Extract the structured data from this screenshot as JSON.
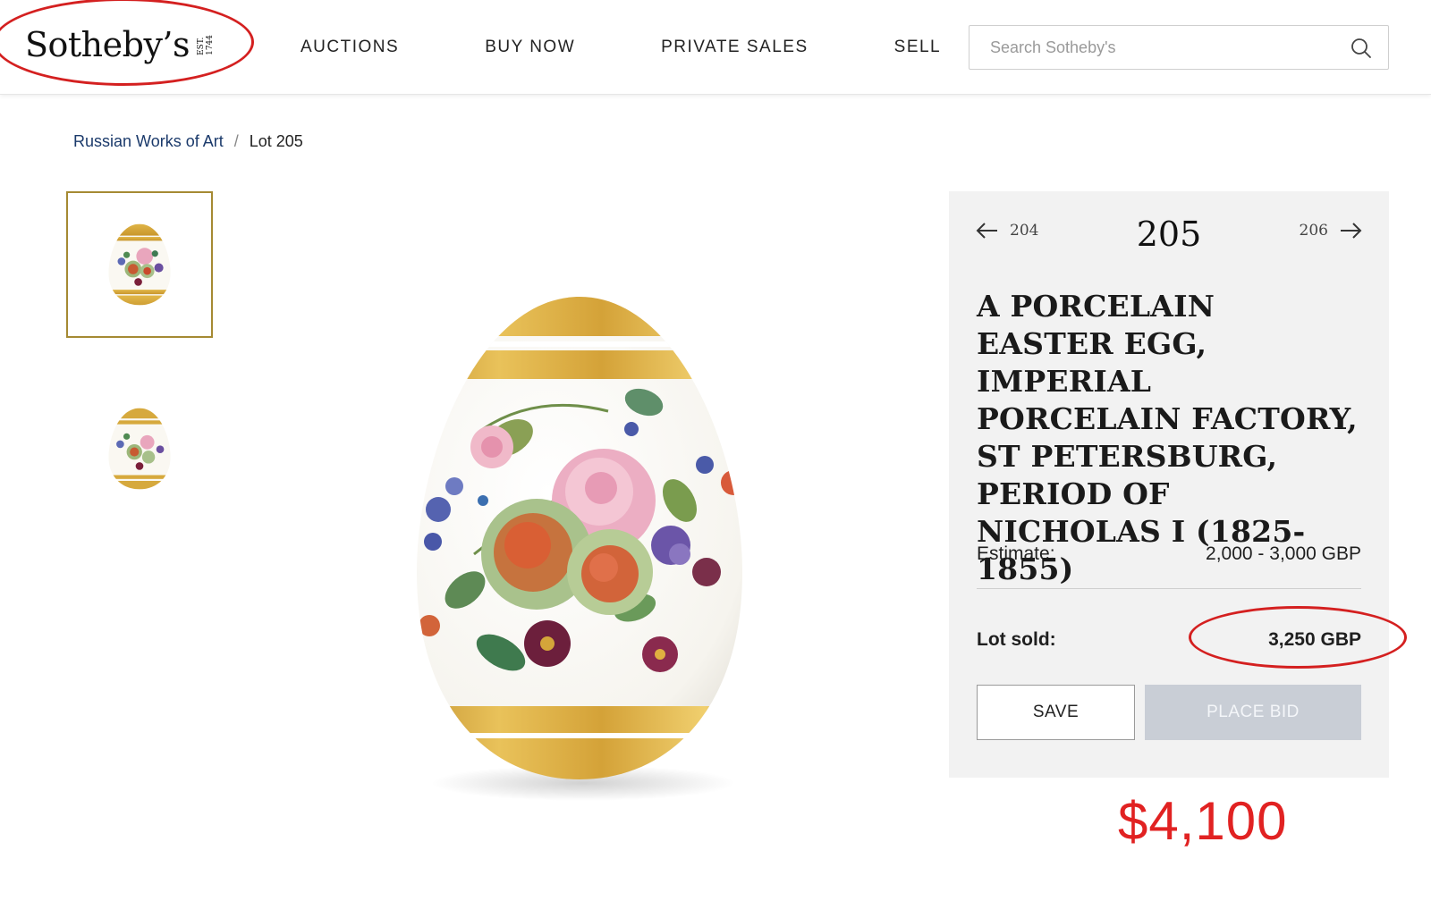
{
  "header": {
    "logo_text": "Sotheby’s",
    "logo_est_line1": "EST.",
    "logo_est_line2": "1744",
    "nav": [
      "AUCTIONS",
      "BUY NOW",
      "PRIVATE SALES",
      "SELL"
    ],
    "search_placeholder": "Search Sotheby's"
  },
  "breadcrumb": {
    "category": "Russian Works of Art",
    "separator": "/",
    "current": "Lot 205"
  },
  "lot": {
    "prev_number": "204",
    "number": "205",
    "next_number": "206",
    "title": "A PORCELAIN EASTER EGG, IMPERIAL PORCELAIN FACTORY, ST PETERSBURG, PERIOD OF NICHOLAS I (1825-1855)",
    "estimate_label": "Estimate:",
    "estimate_value": "2,000 - 3,000 GBP",
    "sold_label": "Lot sold:",
    "sold_value": "3,250 GBP",
    "save_label": "SAVE",
    "bid_label": "PLACE BID"
  },
  "annotation": {
    "usd_value": "$4,100",
    "color": "#e12222"
  },
  "colors": {
    "brand_gold": "#a58a33",
    "link_blue": "#1b3a6b",
    "panel_bg": "#f2f2f2"
  }
}
